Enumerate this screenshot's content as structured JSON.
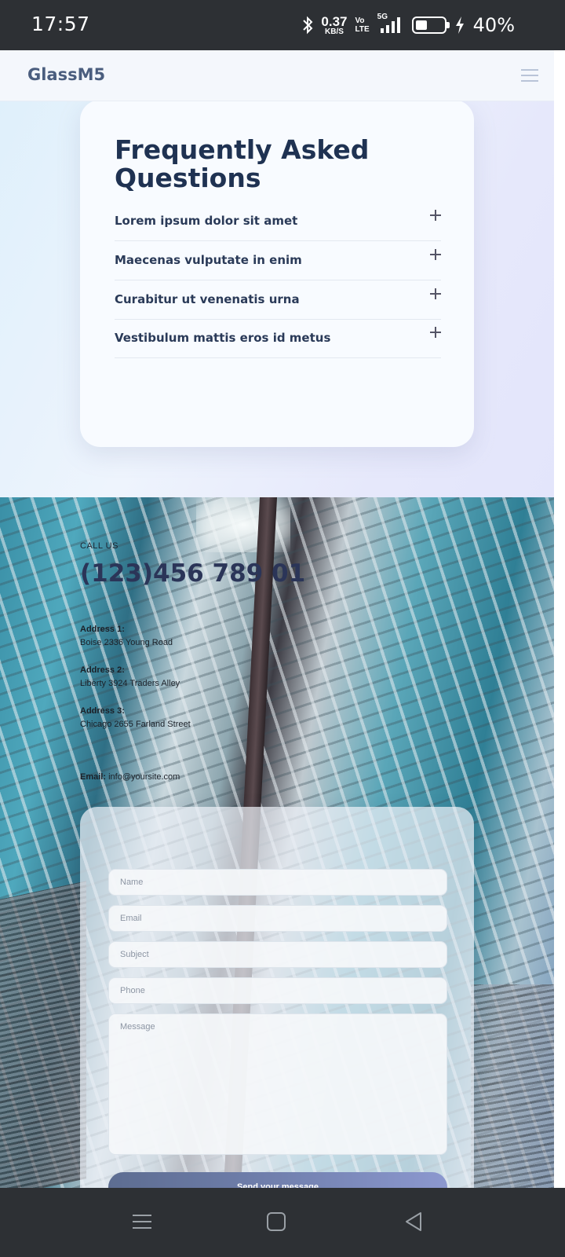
{
  "status_bar": {
    "time": "17:57",
    "net_speed_value": "0.37",
    "net_speed_unit": "KB/S",
    "volte_top": "Vo",
    "volte_bottom": "LTE",
    "network": "5G",
    "battery_percent": "40%",
    "battery_level": 0.4,
    "icons": [
      "bluetooth-icon",
      "signal-icon",
      "battery-icon",
      "charging-icon"
    ]
  },
  "header": {
    "brand": "GlassM5",
    "menu_icon": "hamburger-menu-icon"
  },
  "faq": {
    "title": "Frequently Asked Questions",
    "items": [
      {
        "question": "Lorem ipsum dolor sit amet"
      },
      {
        "question": "Maecenas vulputate in enim"
      },
      {
        "question": "Curabitur ut venenatis urna"
      },
      {
        "question": "Vestibulum mattis eros id metus"
      }
    ]
  },
  "contact": {
    "call_label": "CALL US",
    "phone": "(123)456 789 01",
    "addresses": [
      {
        "label": "Address 1:",
        "value": "Boise 2336 Young Road"
      },
      {
        "label": "Address 2:",
        "value": "Liberty 3924 Traders Alley"
      },
      {
        "label": "Address 3:",
        "value": "Chicago 2655 Farland Street"
      }
    ],
    "email_label": "Email:",
    "email_value": "info@yoursite.com"
  },
  "form": {
    "name_placeholder": "Name",
    "email_placeholder": "Email",
    "subject_placeholder": "Subject",
    "phone_placeholder": "Phone",
    "message_placeholder": "Message",
    "submit_label": "Send your message"
  },
  "nav_bar": {
    "icons": [
      "menu-icon",
      "home-icon",
      "back-icon"
    ]
  }
}
